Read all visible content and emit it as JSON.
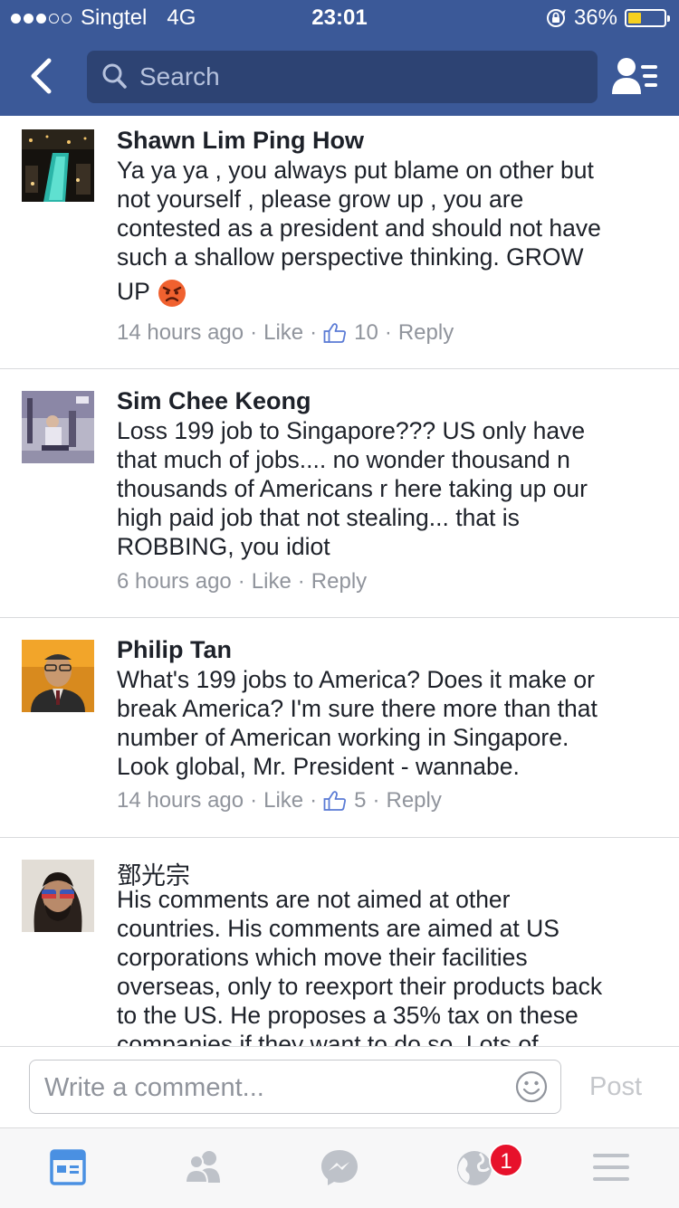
{
  "status_bar": {
    "carrier": "Singtel",
    "network": "4G",
    "time": "23:01",
    "battery": "36%",
    "battery_level": 0.36,
    "signal_bars_filled": 3,
    "signal_bars_total": 5
  },
  "navbar": {
    "search_placeholder": "Search",
    "icons": [
      "back-arrow-icon",
      "search-icon",
      "friends-list-icon"
    ]
  },
  "comments": [
    {
      "author": "Shawn Lim Ping How",
      "lines": [
        "Ya ya ya , you always put blame on other but",
        "not yourself , please grow up , you are",
        "contested as a president and should not have",
        "such a shallow perspective thinking. GROW",
        "UP"
      ],
      "emoji": "angry-face-emoji",
      "time": "14 hours ago",
      "like_label": "Like",
      "likes": "10",
      "reply_label": "Reply"
    },
    {
      "author": "Sim Chee Keong",
      "lines": [
        "Loss 199 job to Singapore??? US only have",
        "that much of jobs.... no wonder thousand n",
        "thousands of Americans r here taking up our",
        "high paid job that not stealing... that is",
        "ROBBING, you idiot"
      ],
      "time": "6 hours ago",
      "like_label": "Like",
      "reply_label": "Reply"
    },
    {
      "author": "Philip Tan",
      "lines": [
        "What's 199 jobs to America? Does it make or",
        "break America? I'm sure there more than that",
        "number of American working in Singapore.",
        "Look global, Mr. President - wannabe."
      ],
      "time": "14 hours ago",
      "like_label": "Like",
      "likes": "5",
      "reply_label": "Reply"
    },
    {
      "author": "鄧光宗",
      "lines": [
        "His comments are not aimed at other",
        "countries. His comments are aimed at US",
        "corporations which move their facilities",
        "overseas, only to reexport their products back",
        "to the US. He proposes a 35% tax on these",
        "companies if they want to do so. Lots of"
      ]
    }
  ],
  "composer": {
    "placeholder": "Write a comment...",
    "post_label": "Post",
    "emoji_icon": "smiley-icon"
  },
  "tabbar": {
    "tabs": [
      "news-feed-icon",
      "friends-icon",
      "messenger-icon",
      "globe-notifications-icon",
      "menu-icon"
    ],
    "notification_badge": "1",
    "active_color": "#4a90e2",
    "inactive_color": "#bec2c9"
  },
  "colors": {
    "brand": "#3b5998",
    "search_bg": "#2d4373",
    "meta_text": "#90949c",
    "badge": "#e7112b"
  }
}
